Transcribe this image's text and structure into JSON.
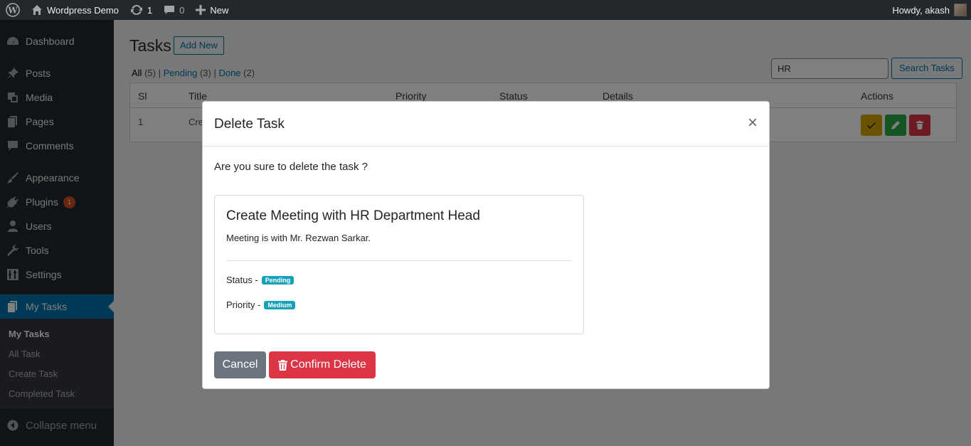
{
  "admin_bar": {
    "site_name": "Wordpress Demo",
    "updates_count": "1",
    "comments_count": "0",
    "new_label": "New",
    "greeting": "Howdy, akash"
  },
  "sidebar": {
    "items": [
      {
        "label": "Dashboard",
        "icon": "dashboard-icon"
      },
      {
        "label": "Posts",
        "icon": "pin-icon"
      },
      {
        "label": "Media",
        "icon": "media-icon"
      },
      {
        "label": "Pages",
        "icon": "pages-icon"
      },
      {
        "label": "Comments",
        "icon": "comment-icon"
      },
      {
        "label": "Appearance",
        "icon": "paintbrush-icon"
      },
      {
        "label": "Plugins",
        "icon": "plugin-icon",
        "badge": "1"
      },
      {
        "label": "Users",
        "icon": "user-icon"
      },
      {
        "label": "Tools",
        "icon": "wrench-icon"
      },
      {
        "label": "Settings",
        "icon": "settings-icon"
      },
      {
        "label": "My Tasks",
        "icon": "tasks-icon"
      }
    ],
    "submenu": [
      "My Tasks",
      "All Task",
      "Create Task",
      "Completed Task"
    ],
    "collapse_label": "Collapse menu"
  },
  "page": {
    "title": "Tasks",
    "add_new": "Add New",
    "filters": {
      "all": "All",
      "all_count": "(5)",
      "pending": "Pending",
      "pending_count": "(3)",
      "done": "Done",
      "done_count": "(2)"
    },
    "search_value": "HR",
    "search_button": "Search Tasks",
    "table": {
      "headers": [
        "Sl",
        "Title",
        "Priority",
        "Status",
        "Details",
        "Actions"
      ],
      "rows": [
        {
          "sl": "1",
          "title": "Cre"
        }
      ]
    }
  },
  "modal": {
    "title": "Delete Task",
    "close": "×",
    "question": "Are you sure to delete the task ?",
    "card": {
      "title": "Create Meeting with HR Department Head",
      "description": "Meeting is with Mr. Rezwan Sarkar.",
      "status_label": "Status -",
      "status_value": "Pending",
      "priority_label": "Priority -",
      "priority_value": "Medium"
    },
    "cancel": "Cancel",
    "confirm": "Confirm Delete"
  },
  "colors": {
    "admin_bar": "#23282d",
    "current_menu": "#0073aa",
    "danger": "#dc3545",
    "secondary": "#6c757d",
    "info": "#17a2b8",
    "warning": "#d4a500",
    "success": "#28a745"
  }
}
